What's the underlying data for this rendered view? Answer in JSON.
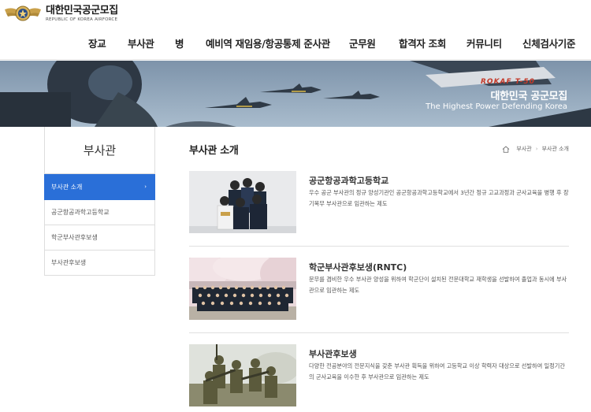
{
  "brand": {
    "title": "대한민국공군모집",
    "subtitle": "REPUBLIC OF KOREA AIRFORCE"
  },
  "gnb": [
    "장교",
    "부사관",
    "병",
    "예비역 재임용/항공통제 준사관",
    "군무원",
    "합격자 조회",
    "커뮤니티",
    "신체검사기준"
  ],
  "hero": {
    "title": "대한민국 공군모집",
    "subtitle": "The Highest Power Defending Korea",
    "aircraft_tail": "ROKAF T-50"
  },
  "sidebar": {
    "heading": "부사관",
    "items": [
      {
        "label": "부사관 소개",
        "active": true
      },
      {
        "label": "공군항공과학고등학교",
        "active": false
      },
      {
        "label": "학군부사관후보생",
        "active": false
      },
      {
        "label": "부사관후보생",
        "active": false
      }
    ]
  },
  "content": {
    "title": "부사관 소개",
    "breadcrumb": [
      "부사관",
      "부사관 소개"
    ],
    "entries": [
      {
        "title": "공군항공과학고등학교",
        "desc": "우수 공군 부사관의 정규 양성기관인 공군항공과학고등학교에서 3년간 정규 고교과정과 군사교육을 병행 후 장기복무 부사관으로 임관하는 제도"
      },
      {
        "title": "학군부사관후보생(RNTC)",
        "desc": "문무를 겸비한 우수 부사관 양성을 위하여 학군단이 설치된 전문대학교 재학생을 선발하여 졸업과 동시에 부사관으로 임관하는 제도"
      },
      {
        "title": "부사관후보생",
        "desc": "다양한 전공분야의 전문지식을 갖춘 부사관 획득을 위하여 고등학교 이상 학력자 대상으로 선발하여 일정기간의 군사교육을 이수한 후 부사관으로 임관하는 제도"
      }
    ]
  },
  "colors": {
    "active_menu": "#2a6fd8"
  }
}
